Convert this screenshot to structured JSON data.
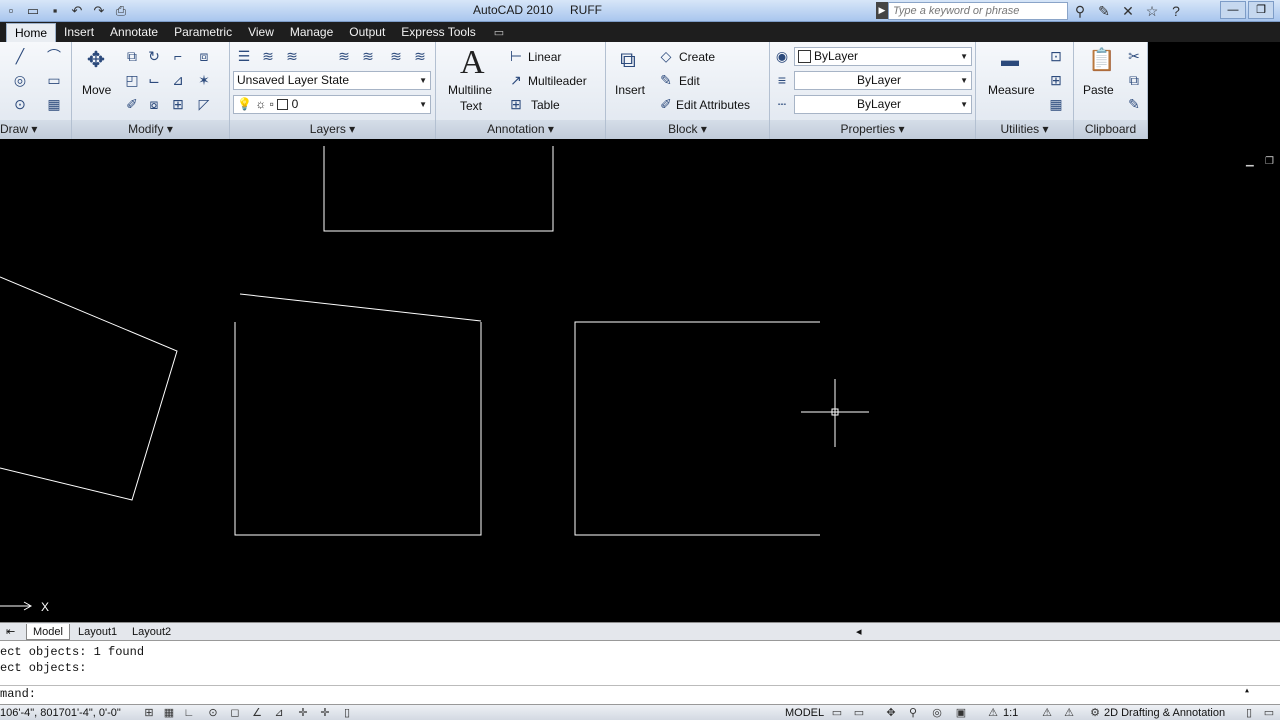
{
  "title": {
    "app": "AutoCAD 2010",
    "file": "RUFF"
  },
  "search": {
    "placeholder": "Type a keyword or phrase"
  },
  "quick_access": [
    "new-icon",
    "open-icon",
    "save-icon",
    "undo-icon",
    "redo-icon",
    "plot-icon"
  ],
  "tabs": [
    "Home",
    "Insert",
    "Annotate",
    "Parametric",
    "View",
    "Manage",
    "Output",
    "Express Tools"
  ],
  "panels": {
    "draw": "Draw",
    "modify": {
      "title": "Modify",
      "move": "Move"
    },
    "layers": {
      "title": "Layers",
      "layer_state": "Unsaved Layer State",
      "current_layer": "0"
    },
    "annotation": {
      "title": "Annotation",
      "multiline_text_1": "Multiline",
      "multiline_text_2": "Text",
      "linear": "Linear",
      "multileader": "Multileader",
      "table": "Table"
    },
    "block": {
      "title": "Block",
      "insert": "Insert",
      "create": "Create",
      "edit": "Edit",
      "edit_attributes": "Edit Attributes"
    },
    "properties": {
      "title": "Properties",
      "color": "ByLayer",
      "linetype": "ByLayer",
      "lineweight": "ByLayer"
    },
    "utilities": {
      "title": "Utilities",
      "measure": "Measure"
    },
    "clipboard": {
      "title": "Clipboard",
      "paste": "Paste"
    }
  },
  "ucs": {
    "x_label": "X"
  },
  "layout_tabs": [
    "Model",
    "Layout1",
    "Layout2"
  ],
  "command_lines": [
    "ect objects: 1 found",
    "ect objects:",
    "mand:"
  ],
  "status": {
    "coordinates": "106'-4\", 801701'-4\", 0'-0\"",
    "model": "MODEL",
    "scale": "1:1",
    "workspace": "2D Drafting & Annotation"
  },
  "colors": {
    "background": "#000000",
    "geometry": "#ffffff",
    "ribbon_dark": "#1e1e1e"
  }
}
